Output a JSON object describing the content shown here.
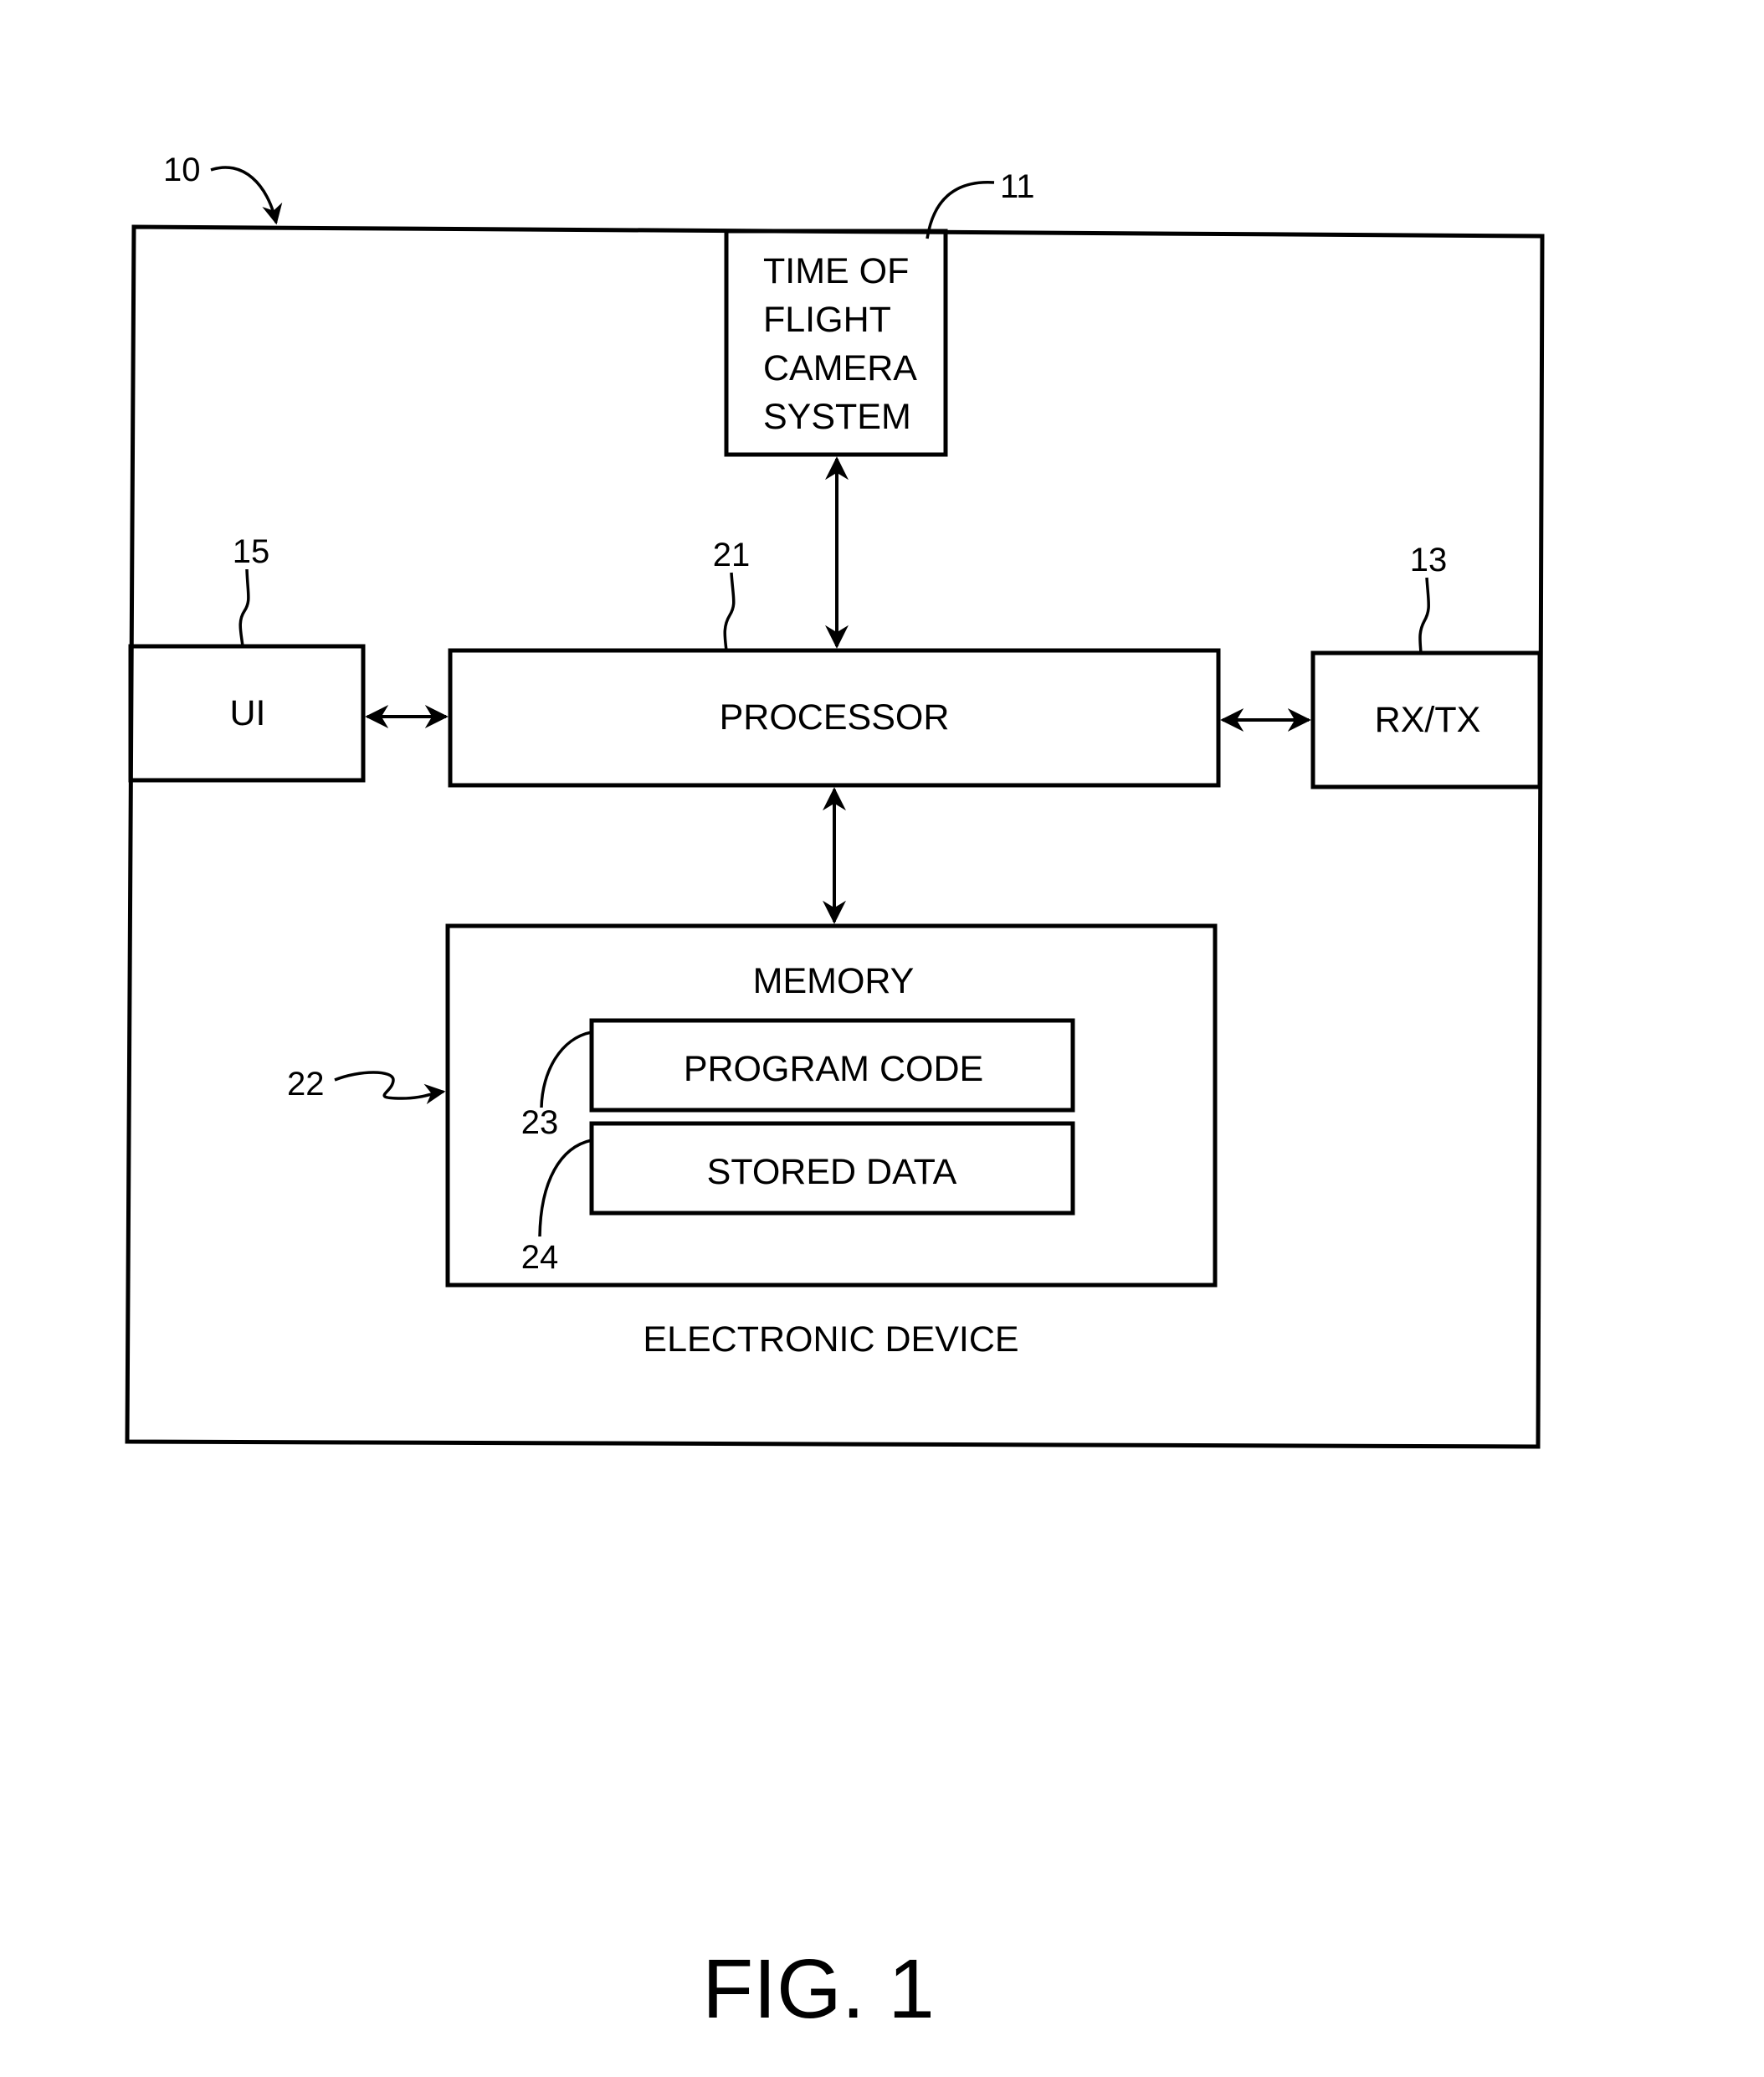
{
  "figure": {
    "caption": "FIG. 1",
    "device_label": "ELECTRONIC DEVICE",
    "refs": {
      "device": "10",
      "tof_camera": "11",
      "rxtx": "13",
      "ui": "15",
      "processor": "21",
      "memory": "22",
      "program_code": "23",
      "stored_data": "24"
    },
    "blocks": {
      "tof_camera": [
        "TIME OF",
        "FLIGHT",
        "CAMERA",
        "SYSTEM"
      ],
      "ui": "UI",
      "processor": "PROCESSOR",
      "rxtx": "RX/TX",
      "memory": "MEMORY",
      "program_code": "PROGRAM CODE",
      "stored_data": "STORED DATA"
    },
    "connections": [
      {
        "from": "tof_camera",
        "to": "processor",
        "type": "bidirectional"
      },
      {
        "from": "ui",
        "to": "processor",
        "type": "bidirectional"
      },
      {
        "from": "processor",
        "to": "rxtx",
        "type": "bidirectional"
      },
      {
        "from": "processor",
        "to": "memory",
        "type": "bidirectional"
      }
    ]
  }
}
